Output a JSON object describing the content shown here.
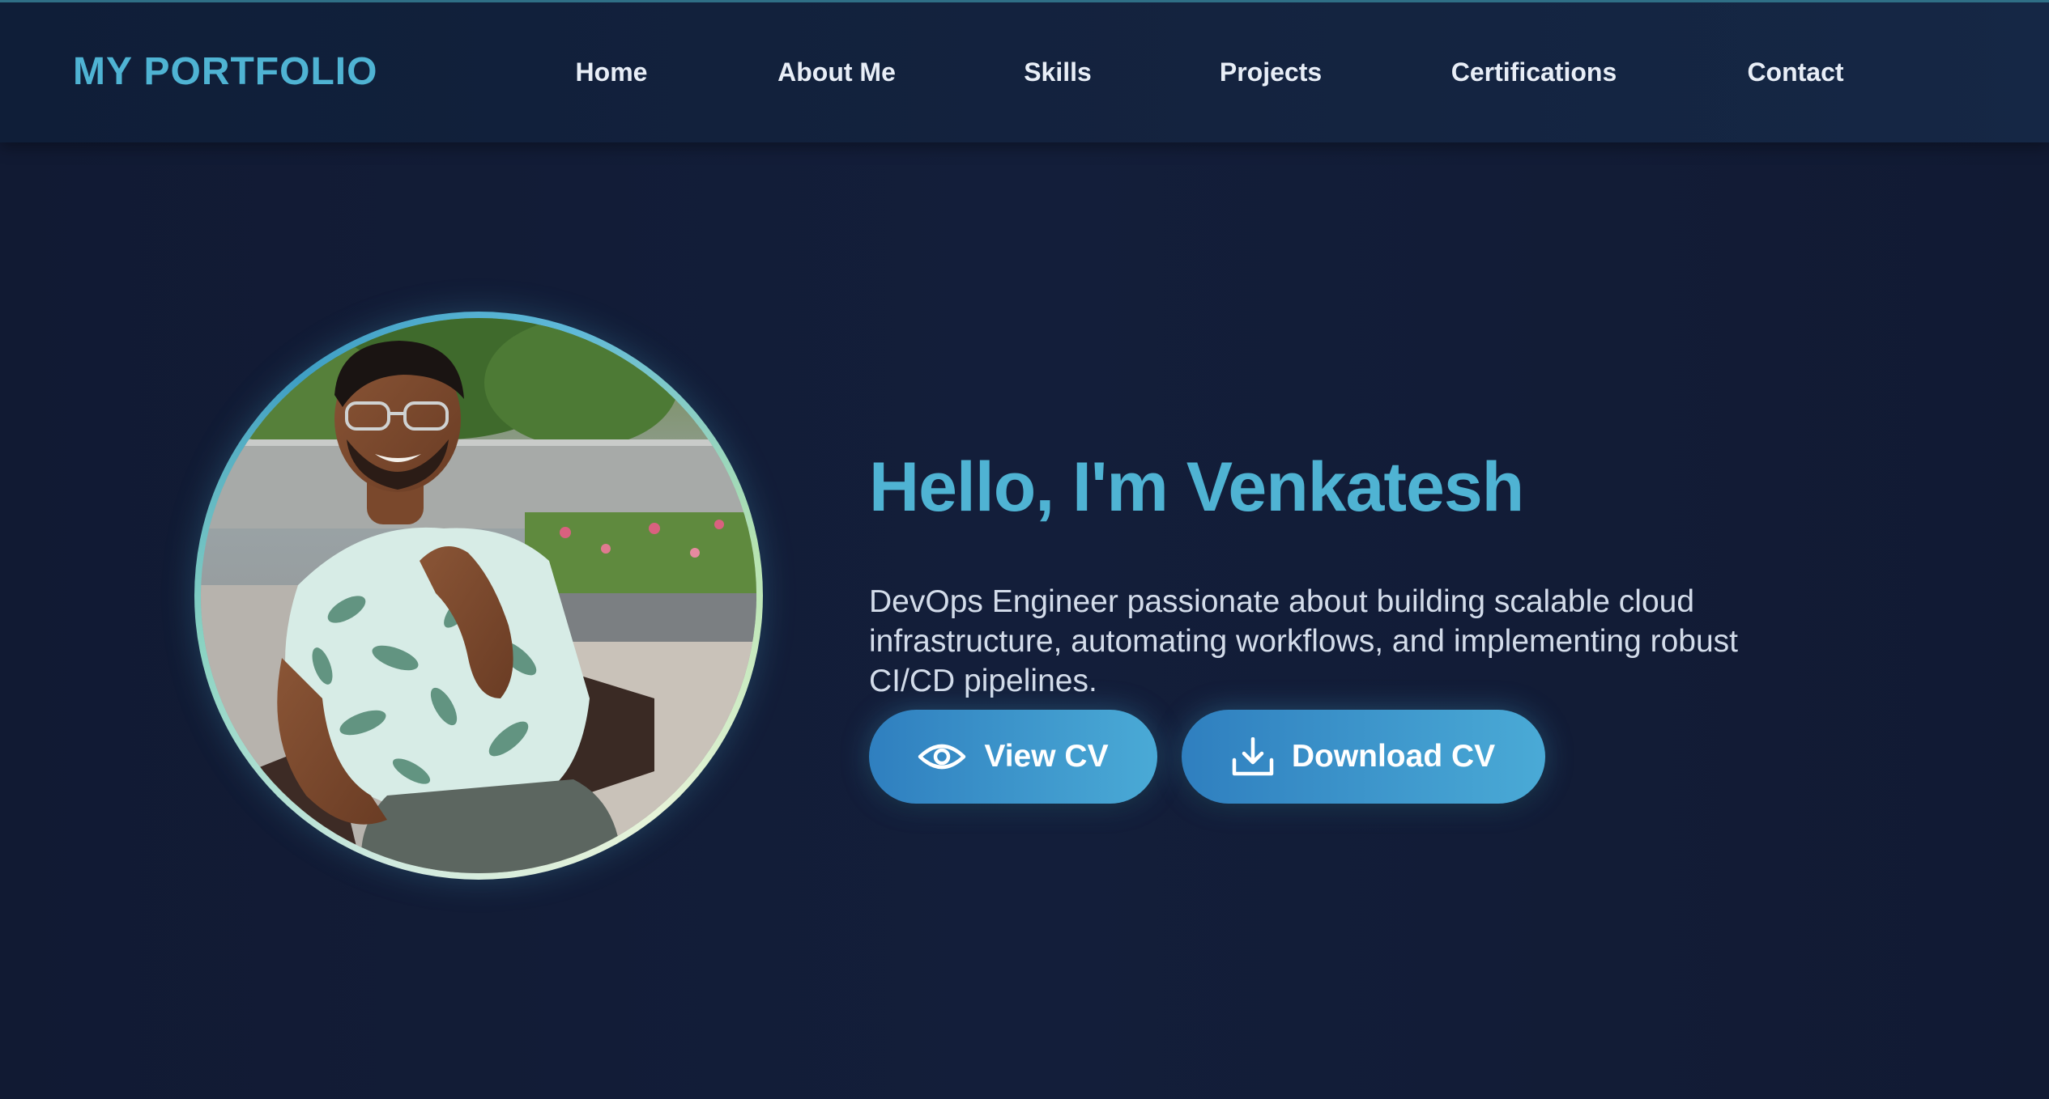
{
  "brand": "MY PORTFOLIO",
  "nav": {
    "items": [
      {
        "label": "Home"
      },
      {
        "label": "About Me"
      },
      {
        "label": "Skills"
      },
      {
        "label": "Projects"
      },
      {
        "label": "Certifications"
      },
      {
        "label": "Contact"
      }
    ]
  },
  "hero": {
    "title": "Hello, I'm Venkatesh",
    "description": "DevOps Engineer passionate about building scalable cloud infrastructure, automating workflows, and implementing robust CI/CD pipelines.",
    "buttons": {
      "view_cv": {
        "label": "View CV",
        "icon": "eye-icon"
      },
      "download_cv": {
        "label": "Download CV",
        "icon": "download-icon"
      }
    }
  },
  "colors": {
    "accent": "#4fb3d3",
    "background": "#111b35",
    "button_start": "#2f7fbf",
    "button_end": "#4aaad6"
  }
}
